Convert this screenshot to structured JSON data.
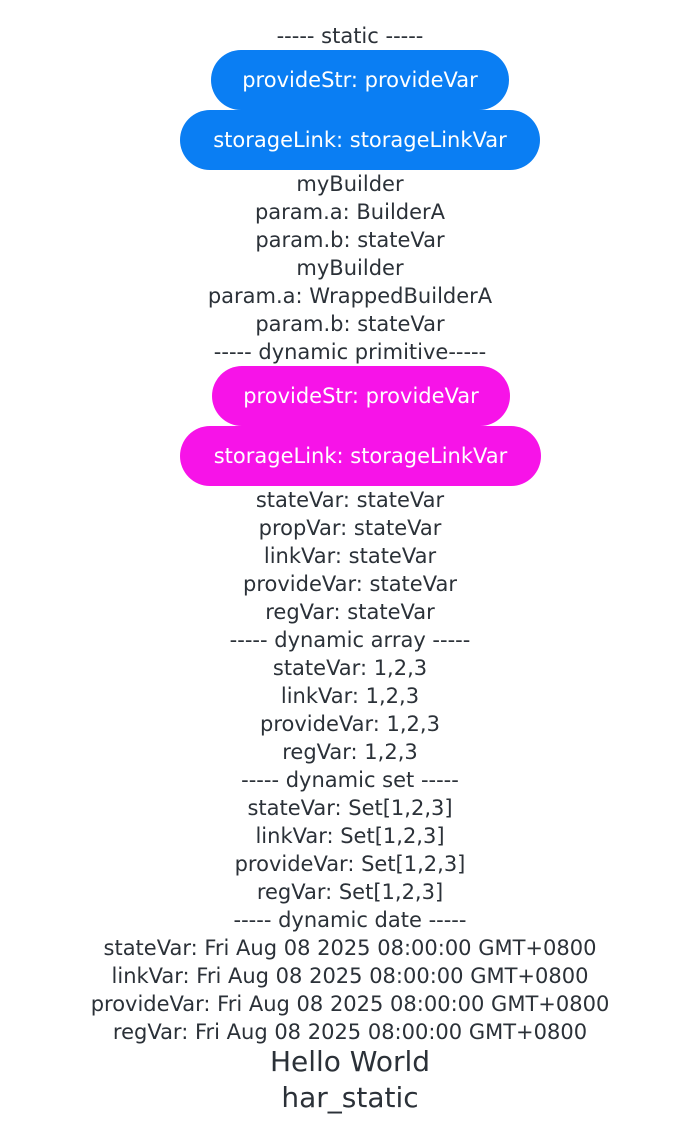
{
  "static_section": {
    "header": "----- static -----",
    "buttons": {
      "provide": "provideStr: provideVar",
      "storage": "storageLink: storageLinkVar"
    },
    "builder1": {
      "title": "myBuilder",
      "param_a": "param.a: BuilderA",
      "param_b": "param.b: stateVar"
    },
    "builder2": {
      "title": "myBuilder",
      "param_a": "param.a: WrappedBuilderA",
      "param_b": "param.b: stateVar"
    }
  },
  "dynamic_primitive": {
    "header": "----- dynamic primitive-----",
    "buttons": {
      "provide": "provideStr: provideVar",
      "storage": "storageLink: storageLinkVar"
    },
    "lines": [
      "stateVar: stateVar",
      "propVar: stateVar",
      "linkVar: stateVar",
      "provideVar: stateVar",
      "regVar: stateVar"
    ]
  },
  "dynamic_array": {
    "header": "----- dynamic array -----",
    "lines": [
      "stateVar: 1,2,3",
      "linkVar: 1,2,3",
      "provideVar: 1,2,3",
      "regVar: 1,2,3"
    ]
  },
  "dynamic_set": {
    "header": "----- dynamic set -----",
    "lines": [
      "stateVar: Set[1,2,3]",
      "linkVar: Set[1,2,3]",
      "provideVar: Set[1,2,3]",
      "regVar: Set[1,2,3]"
    ]
  },
  "dynamic_date": {
    "header": "----- dynamic date -----",
    "lines": [
      "stateVar: Fri Aug 08 2025 08:00:00 GMT+0800",
      "linkVar: Fri Aug 08 2025 08:00:00 GMT+0800",
      "provideVar: Fri Aug 08 2025 08:00:00 GMT+0800",
      "regVar: Fri Aug 08 2025 08:00:00 GMT+0800"
    ]
  },
  "footer": {
    "hello": "Hello World",
    "har": "har_static"
  },
  "colors": {
    "static_button": "#0a7ef3",
    "dynamic_button": "#f713e8",
    "text": "#2b3138"
  }
}
